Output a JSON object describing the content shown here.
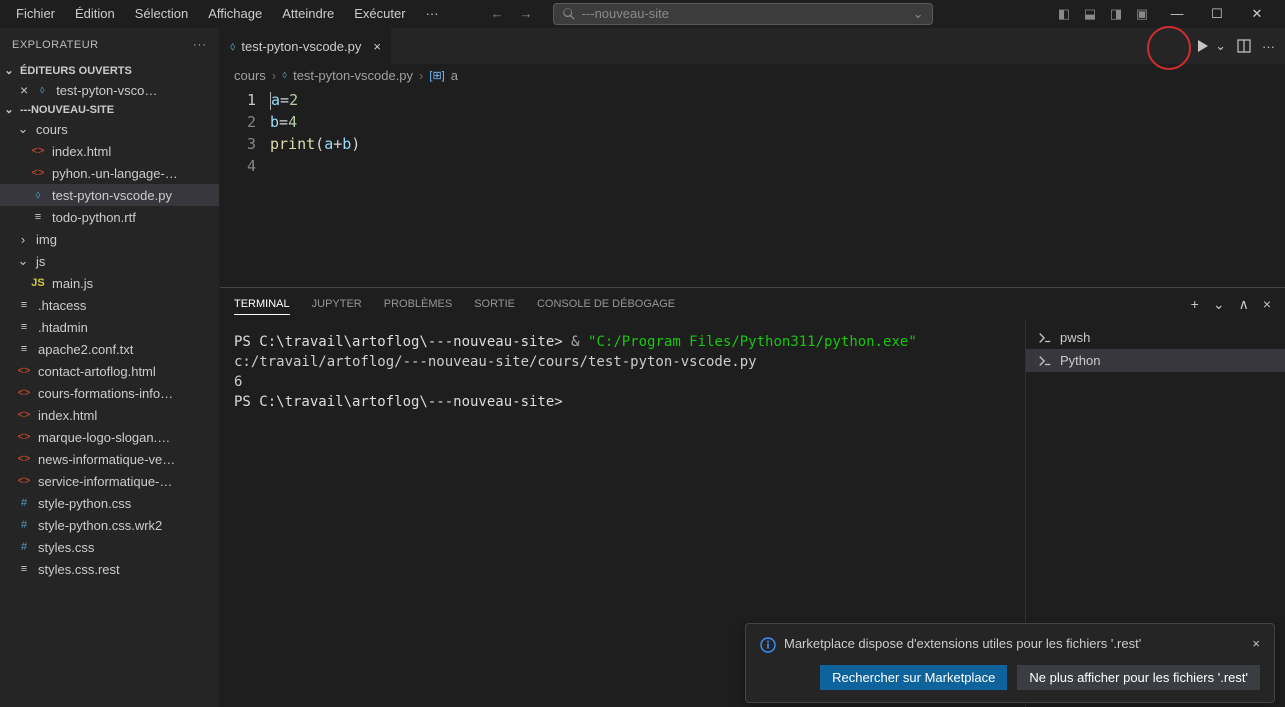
{
  "menubar": [
    "Fichier",
    "Édition",
    "Sélection",
    "Affichage",
    "Atteindre",
    "Exécuter",
    "···"
  ],
  "search_placeholder": "---nouveau-site",
  "explorer": {
    "title": "EXPLORATEUR",
    "open_editors": "ÉDITEURS OUVERTS",
    "open_file": "test-pyton-vsco…",
    "workspace": "---NOUVEAU-SITE",
    "tree": [
      {
        "type": "folder",
        "name": "cours",
        "open": true,
        "depth": 1
      },
      {
        "type": "file",
        "name": "index.html",
        "icon": "html",
        "depth": 2
      },
      {
        "type": "file",
        "name": "pyhon.-un-langage-…",
        "icon": "html",
        "depth": 2
      },
      {
        "type": "file",
        "name": "test-pyton-vscode.py",
        "icon": "py",
        "depth": 2,
        "selected": true
      },
      {
        "type": "file",
        "name": "todo-python.rtf",
        "icon": "rtf",
        "depth": 2
      },
      {
        "type": "folder",
        "name": "img",
        "open": false,
        "depth": 1
      },
      {
        "type": "folder",
        "name": "js",
        "open": true,
        "depth": 1
      },
      {
        "type": "file",
        "name": "main.js",
        "icon": "js",
        "depth": 2
      },
      {
        "type": "file",
        "name": ".htacess",
        "icon": "rtf",
        "depth": 1
      },
      {
        "type": "file",
        "name": ".htadmin",
        "icon": "rtf",
        "depth": 1
      },
      {
        "type": "file",
        "name": "apache2.conf.txt",
        "icon": "rtf",
        "depth": 1
      },
      {
        "type": "file",
        "name": "contact-artoflog.html",
        "icon": "html",
        "depth": 1
      },
      {
        "type": "file",
        "name": "cours-formations-info…",
        "icon": "html",
        "depth": 1
      },
      {
        "type": "file",
        "name": "index.html",
        "icon": "html",
        "depth": 1
      },
      {
        "type": "file",
        "name": "marque-logo-slogan.…",
        "icon": "html",
        "depth": 1
      },
      {
        "type": "file",
        "name": "news-informatique-ve…",
        "icon": "html",
        "depth": 1
      },
      {
        "type": "file",
        "name": "service-informatique-…",
        "icon": "html",
        "depth": 1
      },
      {
        "type": "file",
        "name": "style-python.css",
        "icon": "css",
        "depth": 1
      },
      {
        "type": "file",
        "name": "style-python.css.wrk2",
        "icon": "css",
        "depth": 1
      },
      {
        "type": "file",
        "name": "styles.css",
        "icon": "css",
        "depth": 1
      },
      {
        "type": "file",
        "name": "styles.css.rest",
        "icon": "rtf",
        "depth": 1
      }
    ]
  },
  "tab": {
    "filename": "test-pyton-vscode.py"
  },
  "breadcrumbs": {
    "folder": "cours",
    "file": "test-pyton-vscode.py",
    "symbol": "a"
  },
  "code": {
    "lines": [
      "a=2",
      "b=4",
      "print(a+b)",
      ""
    ]
  },
  "panel": {
    "tabs": [
      "TERMINAL",
      "JUPYTER",
      "PROBLÈMES",
      "SORTIE",
      "CONSOLE DE DÉBOGAGE"
    ],
    "active_tab": "TERMINAL",
    "terminal_lines": [
      {
        "prompt": "PS C:\\travail\\artoflog\\---nouveau-site>",
        "amp": " & ",
        "exe": "\"C:/Program Files/Python311/python.exe\""
      },
      {
        "plain": "c:/travail/artoflog/---nouveau-site/cours/test-pyton-vscode.py"
      },
      {
        "plain": "6"
      },
      {
        "prompt": "PS C:\\travail\\artoflog\\---nouveau-site>"
      }
    ],
    "term_sessions": [
      "pwsh",
      "Python"
    ],
    "term_selected": 1
  },
  "notification": {
    "message": "Marketplace dispose d'extensions utiles pour les fichiers '.rest'",
    "primary": "Rechercher sur Marketplace",
    "secondary": "Ne plus afficher pour les fichiers '.rest'"
  }
}
